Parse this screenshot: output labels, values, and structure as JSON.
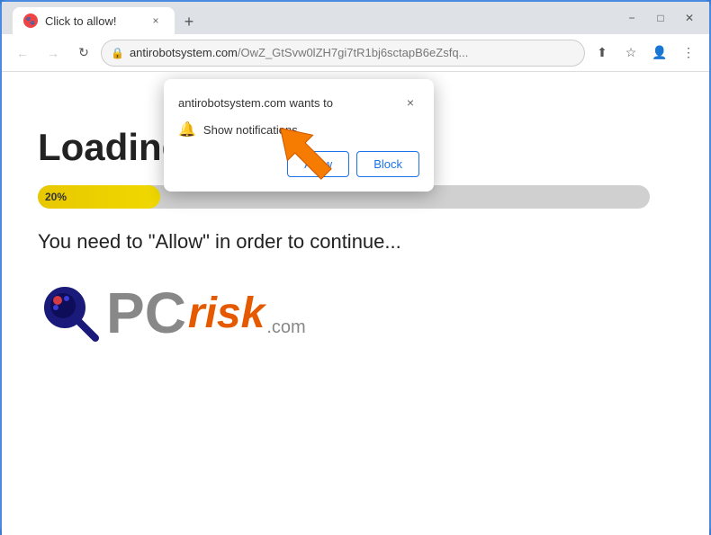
{
  "window": {
    "title": "Click to allow!",
    "tab_close_label": "×",
    "new_tab_label": "+",
    "minimize_label": "−",
    "maximize_label": "□",
    "close_label": "✕"
  },
  "nav": {
    "back_label": "←",
    "forward_label": "→",
    "reload_label": "↻",
    "url_display": "antirobotsystem.com/OwZ_GtSvw0lZH7gi7tR1bj6sctapB6eZsfq...",
    "url_domain": "antirobotsystem.com",
    "url_path": "/OwZ_GtSvw0lZH7gi7tR1bj6sctapB6eZsfq...",
    "share_icon": "⬆",
    "star_icon": "☆",
    "profile_icon": "👤",
    "menu_icon": "⋮"
  },
  "popup": {
    "title": "antirobotsystem.com wants to",
    "close_label": "×",
    "notification_item_text": "Show notifications",
    "allow_label": "Allow",
    "block_label": "Block"
  },
  "page": {
    "loading_text": "Loading...",
    "progress_percent": "20%",
    "progress_width": "20%",
    "instruction_text": "You need to \"Allow\" in order to continue...",
    "logo_pc": "PC",
    "logo_risk": "risk",
    "logo_dotcom": ".com"
  }
}
